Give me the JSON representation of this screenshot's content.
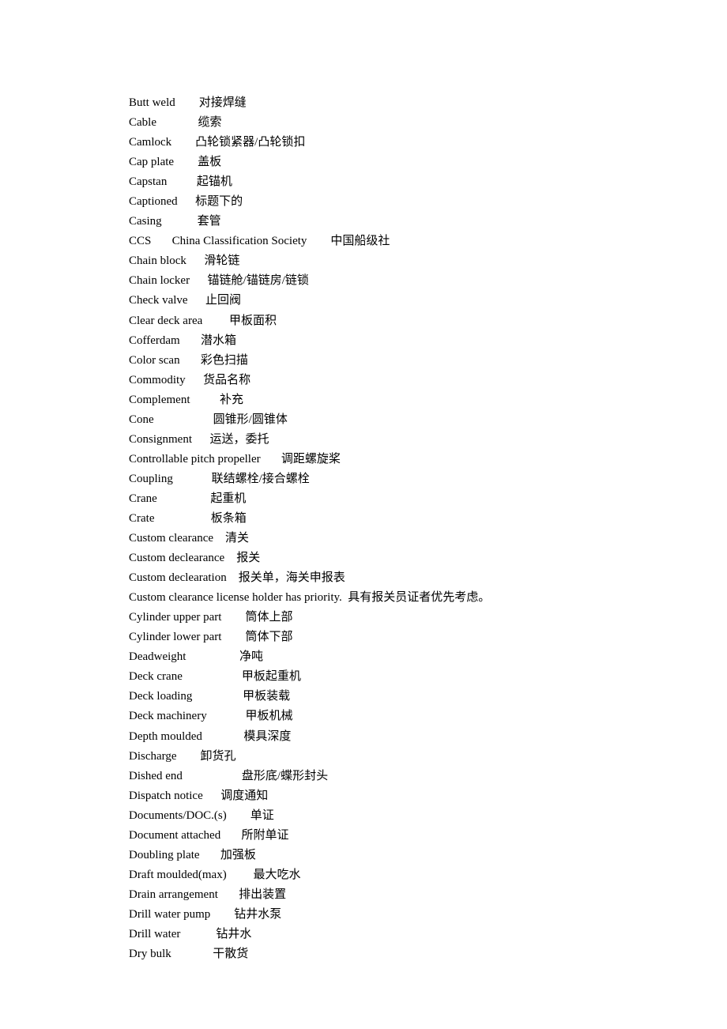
{
  "entries": [
    "Butt weld        对接焊缝",
    "Cable              缆索",
    "Camlock        凸轮锁紧器/凸轮锁扣",
    "Cap plate        盖板",
    "Capstan          起锚机",
    "Captioned      标题下的",
    "Casing            套管",
    "CCS       China Classification Society        中国船级社",
    "Chain block      滑轮链",
    "Chain locker      锚链舱/锚链房/链锁",
    "Check valve      止回阀",
    "Clear deck area         甲板面积",
    "Cofferdam       潜水箱",
    "Color scan       彩色扫描",
    "Commodity      货品名称",
    "Complement          补充",
    "Cone                    圆锥形/圆锥体",
    "Consignment      运送，委托",
    "Controllable pitch propeller       调距螺旋桨",
    "Coupling             联结螺栓/接合螺栓",
    "Crane                  起重机",
    "Crate                   板条箱",
    "Custom clearance    清关",
    "Custom declearance    报关",
    "Custom declearation    报关单，海关申报表",
    "Custom clearance license holder has priority.  具有报关员证者优先考虑。",
    "Cylinder upper part        筒体上部",
    "Cylinder lower part        筒体下部",
    "Deadweight                  净吨",
    "Deck crane                    甲板起重机",
    "Deck loading                 甲板装载",
    "Deck machinery             甲板机械",
    "Depth moulded              模具深度",
    "Discharge        卸货孔",
    "Dished end                    盘形底/蝶形封头",
    "Dispatch notice      调度通知",
    "Documents/DOC.(s)        单证",
    "Document attached       所附单证",
    "Doubling plate       加强板",
    "Draft moulded(max)         最大吃水",
    "Drain arrangement       排出装置",
    "Drill water pump        钻井水泵",
    "Drill water            钻井水",
    "Dry bulk              干散货"
  ]
}
